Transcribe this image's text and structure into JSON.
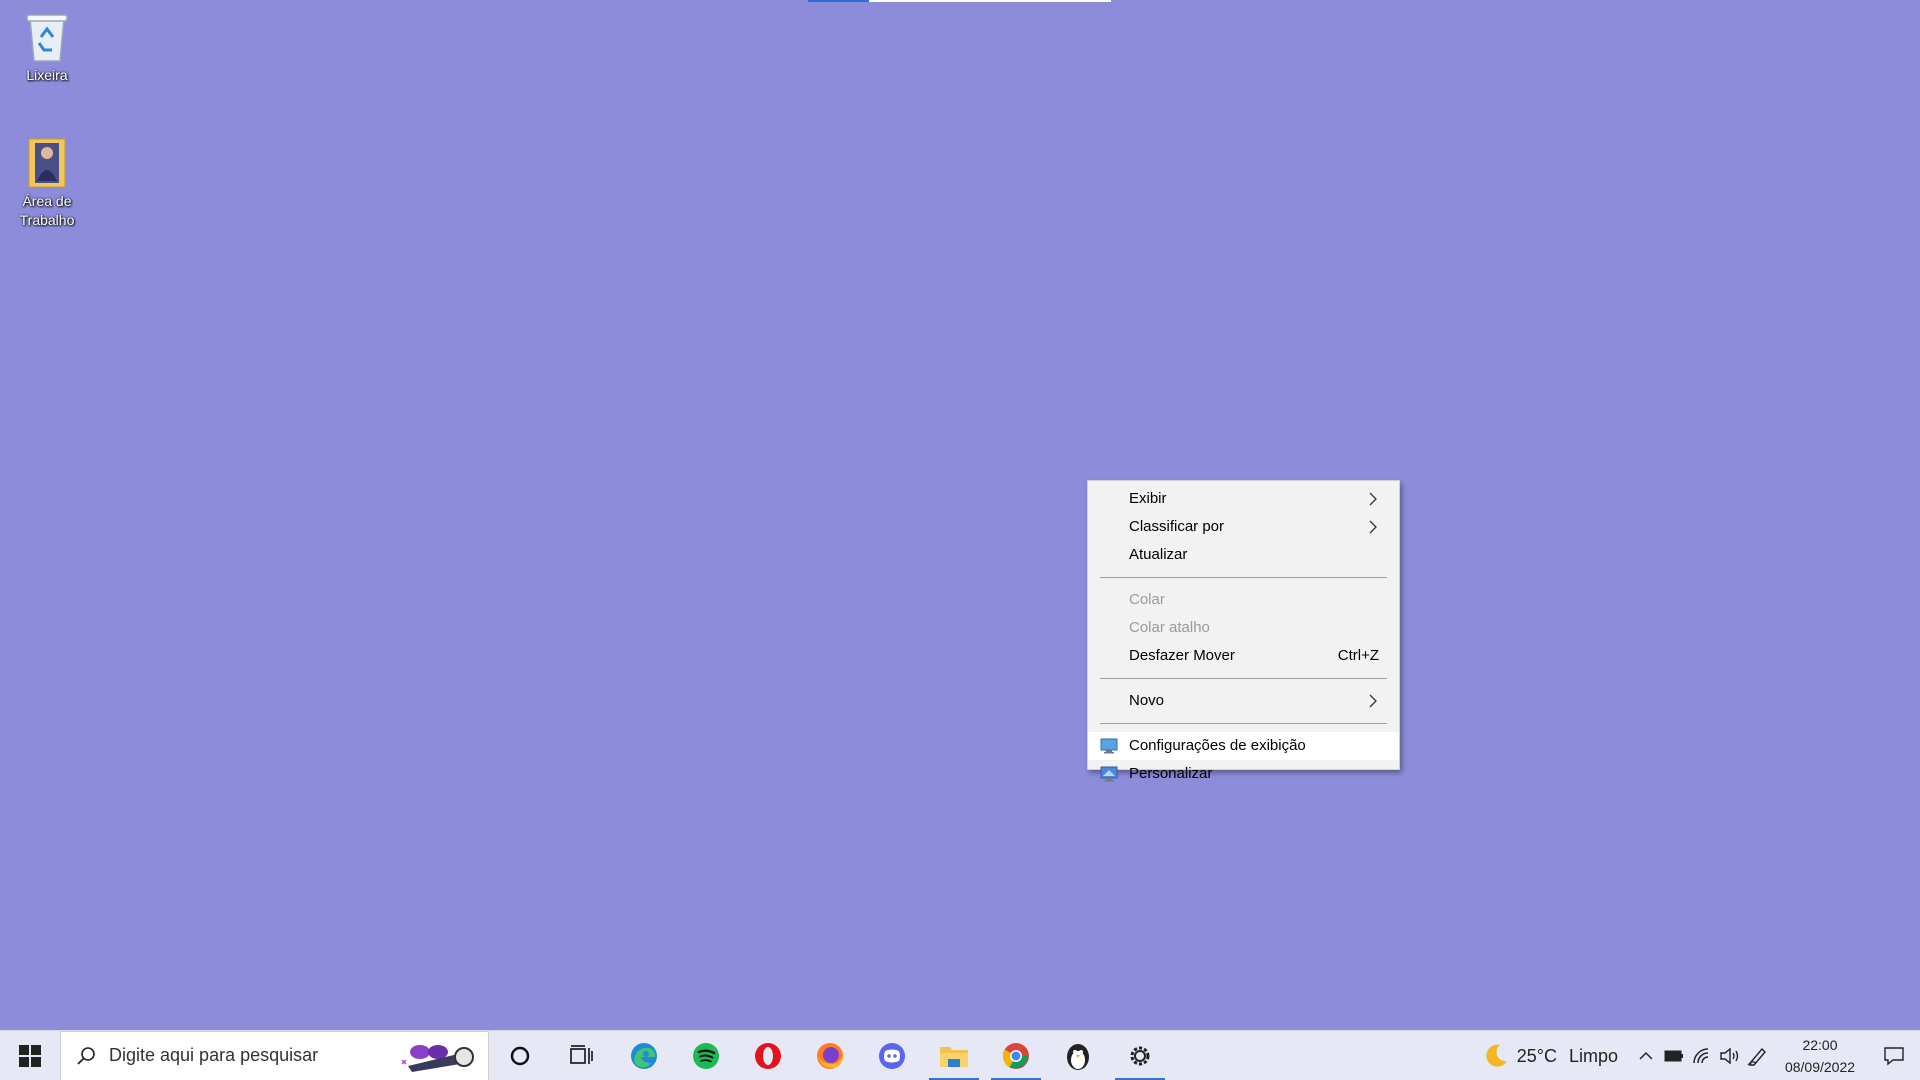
{
  "desktop": {
    "background_color": "#8c8cda",
    "icons": [
      {
        "label": "Lixeira",
        "icon": "recycle-bin-icon"
      },
      {
        "label": "Área de Trabalho",
        "icon": "folder-icon"
      }
    ]
  },
  "context_menu": {
    "items": [
      {
        "label": "Exibir",
        "submenu": true
      },
      {
        "label": "Classificar por",
        "submenu": true
      },
      {
        "label": "Atualizar"
      },
      {
        "label": "Colar",
        "disabled": true
      },
      {
        "label": "Colar atalho",
        "disabled": true
      },
      {
        "label": "Desfazer Mover",
        "shortcut": "Ctrl+Z"
      },
      {
        "label": "Novo",
        "submenu": true
      },
      {
        "label": "Configurações de exibição",
        "icon": "display-settings-icon",
        "highlighted": true
      },
      {
        "label": "Personalizar",
        "icon": "personalize-icon"
      }
    ]
  },
  "taskbar": {
    "search_placeholder": "Digite aqui para pesquisar",
    "apps": [
      {
        "name": "cortana",
        "icon": "cortana-icon"
      },
      {
        "name": "task-view",
        "icon": "task-view-icon"
      },
      {
        "name": "edge",
        "icon": "edge-icon"
      },
      {
        "name": "spotify",
        "icon": "spotify-icon"
      },
      {
        "name": "opera",
        "icon": "opera-icon"
      },
      {
        "name": "firefox",
        "icon": "firefox-icon"
      },
      {
        "name": "discord",
        "icon": "discord-icon"
      },
      {
        "name": "file-explorer",
        "icon": "file-explorer-icon",
        "running": true
      },
      {
        "name": "chrome",
        "icon": "chrome-icon",
        "running": true
      },
      {
        "name": "penguin-app",
        "icon": "penguin-icon"
      },
      {
        "name": "settings",
        "icon": "settings-gear-icon",
        "running": true
      }
    ],
    "weather": {
      "temperature": "25°C",
      "condition": "Limpo",
      "icon": "moon-icon"
    },
    "clock": {
      "time": "22:00",
      "date": "08/09/2022"
    }
  }
}
